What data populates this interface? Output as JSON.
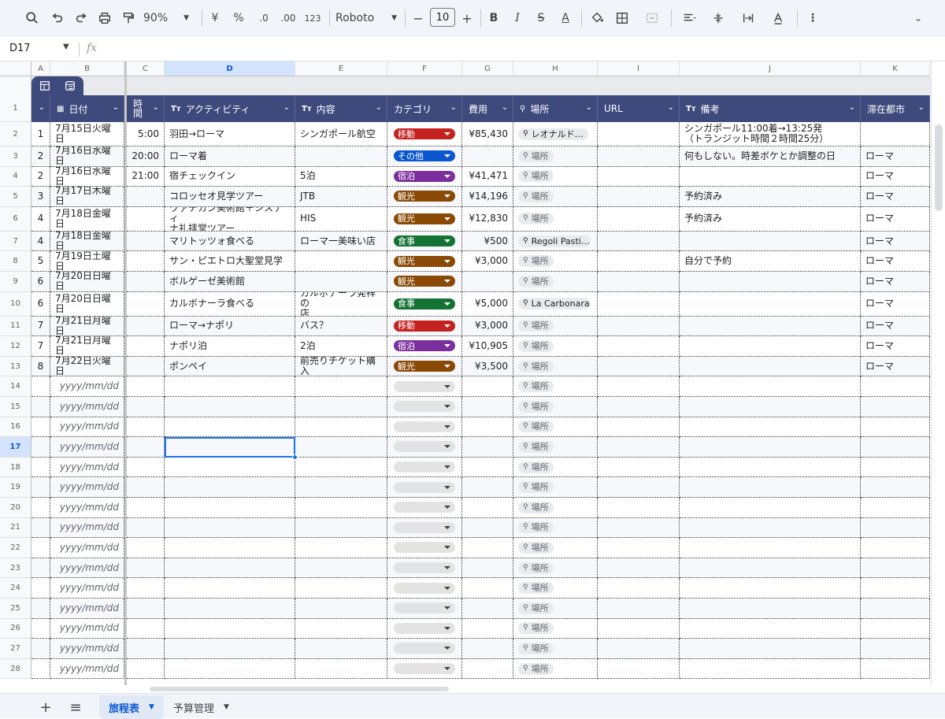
{
  "toolbar": {
    "zoom": "90%",
    "currency": "¥",
    "percent": "%",
    "dec_decrease": ".0",
    "dec_increase": ".00",
    "format_123": "123",
    "font": "Roboto",
    "font_size": "10",
    "minus": "−",
    "plus": "+",
    "bold": "B",
    "italic": "I",
    "strike": "S",
    "text_color": "A"
  },
  "formula_bar": {
    "cell_ref": "D17",
    "fx": "fx"
  },
  "columns": [
    {
      "letter": "A"
    },
    {
      "letter": "B"
    },
    {
      "letter": "C"
    },
    {
      "letter": "D",
      "selected": true
    },
    {
      "letter": "E"
    },
    {
      "letter": "F"
    },
    {
      "letter": "G"
    },
    {
      "letter": "H"
    },
    {
      "letter": "I"
    },
    {
      "letter": "J"
    },
    {
      "letter": "K"
    }
  ],
  "headers": {
    "date": "日付",
    "time": "時\n間",
    "activity": "アクティビティ",
    "content": "内容",
    "category": "カテゴリ",
    "cost": "費用",
    "place": "場所",
    "url": "URL",
    "notes": "備考",
    "city": "滞在都市",
    "text_icon": "Tт"
  },
  "rows": [
    {
      "row": "2",
      "a": "1",
      "b": "7月15日火曜日",
      "c": "5:00",
      "d": "羽田→ローマ",
      "e": "シンガポール航空",
      "f": "移動",
      "fc": "#c5221f",
      "g": "¥85,430",
      "h": "レオナルド…",
      "h_set": true,
      "j": "シンガポール11:00着→13:25発\n（トランジット時間２時間25分）",
      "k": "",
      "tall": true
    },
    {
      "row": "3",
      "a": "2",
      "b": "7月16日水曜日",
      "c": "20:00",
      "d": "ローマ着",
      "e": "",
      "f": "その他",
      "fc": "#0b57d0",
      "g": "",
      "h": "場所",
      "h_set": false,
      "j": "何もしない。時差ボケとか調整の日",
      "k": "ローマ"
    },
    {
      "row": "4",
      "a": "2",
      "b": "7月16日水曜日",
      "c": "21:00",
      "d": "宿チェックイン",
      "e": "5泊",
      "f": "宿泊",
      "fc": "#7b2f9d",
      "g": "¥41,471",
      "h": "場所",
      "h_set": false,
      "j": "",
      "k": "ローマ"
    },
    {
      "row": "5",
      "a": "3",
      "b": "7月17日木曜日",
      "c": "",
      "d": "コロッセオ見学ツアー",
      "e": "JTB",
      "f": "観光",
      "fc": "#8a4a05",
      "g": "¥14,196",
      "h": "場所",
      "h_set": false,
      "j": "予約済み",
      "k": "ローマ"
    },
    {
      "row": "6",
      "a": "4",
      "b": "7月18日金曜日",
      "c": "",
      "d": "ヴァチカン美術館＋システィ\nナ礼拝堂ツアー",
      "e": "HIS",
      "f": "観光",
      "fc": "#8a4a05",
      "g": "¥12,830",
      "h": "場所",
      "h_set": false,
      "j": "予約済み",
      "k": "ローマ",
      "tall": true
    },
    {
      "row": "7",
      "a": "4",
      "b": "7月18日金曜日",
      "c": "",
      "d": "マリトッツォ食べる",
      "e": "ローマ一美味い店",
      "f": "食事",
      "fc": "#137333",
      "g": "¥500",
      "h": "Regoli Pasti…",
      "h_set": true,
      "j": "",
      "k": "ローマ"
    },
    {
      "row": "8",
      "a": "5",
      "b": "7月19日土曜日",
      "c": "",
      "d": "サン・ピエトロ大聖堂見学",
      "e": "",
      "f": "観光",
      "fc": "#8a4a05",
      "g": "¥3,000",
      "h": "場所",
      "h_set": false,
      "j": "自分で予約",
      "k": "ローマ"
    },
    {
      "row": "9",
      "a": "6",
      "b": "7月20日日曜日",
      "c": "",
      "d": "ボルゲーゼ美術館",
      "e": "",
      "f": "観光",
      "fc": "#8a4a05",
      "g": "",
      "h": "場所",
      "h_set": false,
      "j": "",
      "k": "ローマ"
    },
    {
      "row": "10",
      "a": "6",
      "b": "7月20日日曜日",
      "c": "",
      "d": "カルボナーラ食べる",
      "e": "カルボナーラ発祥の\n店",
      "f": "食事",
      "fc": "#137333",
      "g": "¥5,000",
      "h": "La Carbonara",
      "h_set": true,
      "j": "",
      "k": "ローマ",
      "tall": true
    },
    {
      "row": "11",
      "a": "7",
      "b": "7月21日月曜日",
      "c": "",
      "d": "ローマ→ナポリ",
      "e": "バス？",
      "f": "移動",
      "fc": "#c5221f",
      "g": "¥3,000",
      "h": "場所",
      "h_set": false,
      "j": "",
      "k": "ローマ"
    },
    {
      "row": "12",
      "a": "7",
      "b": "7月21日月曜日",
      "c": "",
      "d": "ナポリ泊",
      "e": "2泊",
      "f": "宿泊",
      "fc": "#7b2f9d",
      "g": "¥10,905",
      "h": "場所",
      "h_set": false,
      "j": "",
      "k": "ローマ"
    },
    {
      "row": "13",
      "a": "8",
      "b": "7月22日火曜日",
      "c": "",
      "d": "ポンペイ",
      "e": "前売りチケット購入",
      "f": "観光",
      "fc": "#8a4a05",
      "g": "¥3,500",
      "h": "場所",
      "h_set": false,
      "j": "",
      "k": "ローマ"
    }
  ],
  "empty_rows": [
    "14",
    "15",
    "16",
    "17",
    "18",
    "19",
    "20",
    "21",
    "22",
    "23",
    "24",
    "25",
    "26",
    "27",
    "28"
  ],
  "empty_row_labels": {
    "date_placeholder": "yyyy/mm/dd",
    "place": "場所"
  },
  "selected_row": "17",
  "sheets": [
    {
      "name": "旅程表",
      "active": true
    },
    {
      "name": "予算管理",
      "active": false
    }
  ],
  "sheetbar": {
    "add": "+",
    "list": "≡"
  }
}
